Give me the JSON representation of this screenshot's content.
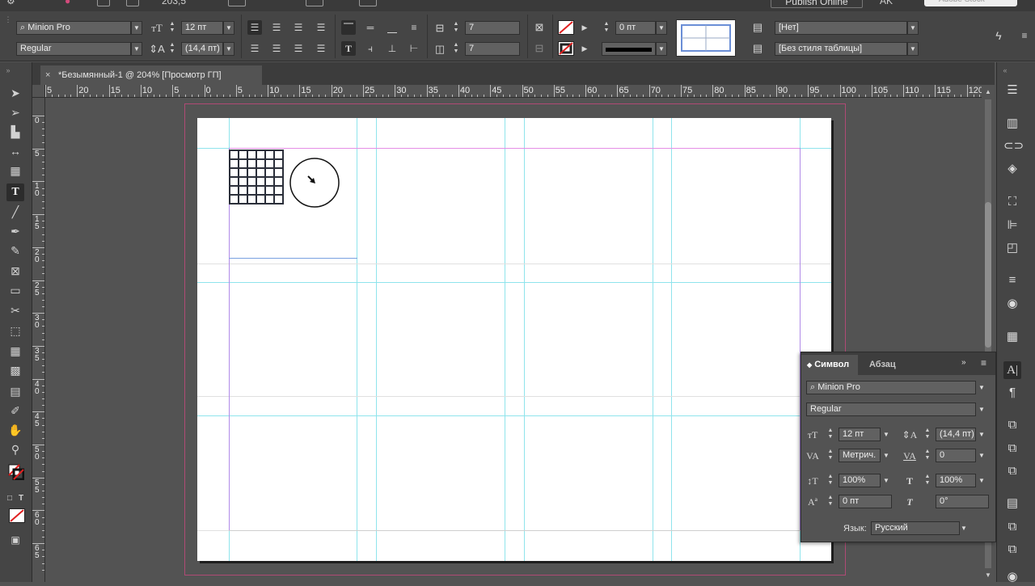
{
  "app_bar": {
    "coords_value": "203,5",
    "publish_label": "Publish Online",
    "user_initials": "AK",
    "search_placeholder": "Adobe Stock"
  },
  "control_panel": {
    "font_family": "Minion Pro",
    "font_style": "Regular",
    "font_size": "12 пт",
    "leading": "(14,4 пт)",
    "columns_field_1": "7",
    "columns_field_2": "7",
    "stroke_weight": "0 пт",
    "cell_style": "[Нет]",
    "table_style": "[Без стиля таблицы]"
  },
  "document_tab": {
    "title": "*Безымянный-1 @ 204% [Просмотр ГП]",
    "close_label": "×"
  },
  "ruler_h_labels": [
    "5",
    "20",
    "15",
    "10",
    "5",
    "0",
    "5",
    "10",
    "15",
    "20",
    "25",
    "30",
    "35",
    "40",
    "45",
    "50",
    "55",
    "60",
    "65",
    "70",
    "75",
    "80",
    "85",
    "90",
    "95",
    "100",
    "105",
    "110",
    "115",
    "120"
  ],
  "ruler_v_labels": [
    "0",
    "5",
    "1\n0",
    "1\n5",
    "2\n0",
    "2\n5",
    "3\n0",
    "3\n5",
    "4\n0",
    "4\n5",
    "5\n0",
    "5\n5",
    "6\n0",
    "6\n5"
  ],
  "character_panel": {
    "tab_active": "Символ",
    "tab_inactive": "Абзац",
    "font_family": "Minion Pro",
    "font_style": "Regular",
    "font_size": "12 пт",
    "leading": "(14,4 пт)",
    "kerning": "Метрич.",
    "tracking": "0",
    "vertical_scale": "100%",
    "horizontal_scale": "100%",
    "baseline_shift": "0 пт",
    "skew": "0°",
    "language_label": "Язык:",
    "language_value": "Русский"
  },
  "colors": {
    "guide_cyan": "#7fe6ec",
    "margin_magenta": "#e58ee6",
    "margin_violet": "#b18be8",
    "frame_blue": "#7aa0e0",
    "bleed_red": "#b04a75"
  }
}
